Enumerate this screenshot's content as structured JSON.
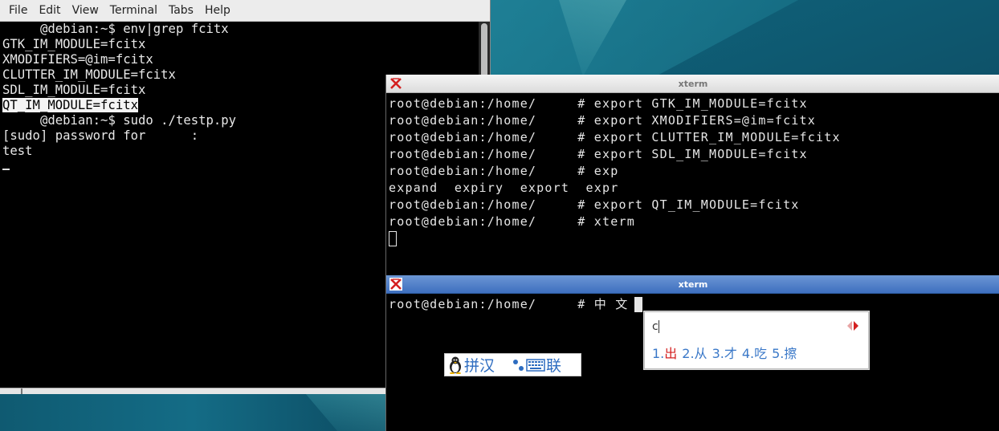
{
  "colors": {
    "terminal_bg": "#000000",
    "terminal_fg": "#e8e8e8",
    "xterm_active_title": "#3e6fbf",
    "ime_candidate": "#3a78c8",
    "ime_highlight": "#d42020"
  },
  "gnome_terminal": {
    "menu": [
      "File",
      "Edit",
      "View",
      "Terminal",
      "Tabs",
      "Help"
    ],
    "lines": [
      {
        "pre": "     ",
        "text": "@debian:~$ env|grep fcitx"
      },
      {
        "pre": "",
        "text": "GTK_IM_MODULE=fcitx"
      },
      {
        "pre": "",
        "text": "XMODIFIERS=@im=fcitx"
      },
      {
        "pre": "",
        "text": "CLUTTER_IM_MODULE=fcitx"
      },
      {
        "pre": "",
        "text": "SDL_IM_MODULE=fcitx"
      },
      {
        "pre": "",
        "text": "QT_IM_MODULE=fcitx",
        "highlight": true
      },
      {
        "pre": "     ",
        "text": "@debian:~$ sudo ./testp.py"
      },
      {
        "pre": "",
        "text": "[sudo] password for      :"
      },
      {
        "pre": "",
        "text": "test"
      }
    ]
  },
  "xterm_top": {
    "title": "xterm",
    "lines": [
      "root@debian:/home/     # export GTK_IM_MODULE=fcitx",
      "root@debian:/home/     # export XMODIFIERS=@im=fcitx",
      "root@debian:/home/     # export CLUTTER_IM_MODULE=fcitx",
      "root@debian:/home/     # export SDL_IM_MODULE=fcitx",
      "root@debian:/home/     # exp",
      "expand  expiry  export  expr",
      "root@debian:/home/     # export QT_IM_MODULE=fcitx",
      "root@debian:/home/     # xterm"
    ]
  },
  "xterm_bottom": {
    "title": "xterm",
    "line": "root@debian:/home/     # 中 文"
  },
  "ime_popup": {
    "preedit": "c",
    "candidates": [
      {
        "num": "1.",
        "word": "出"
      },
      {
        "num": "2.",
        "word": "从"
      },
      {
        "num": "3.",
        "word": "才"
      },
      {
        "num": "4.",
        "word": "吃"
      },
      {
        "num": "5.",
        "word": "擦"
      }
    ]
  },
  "ime_status": {
    "mode_text": "拼汉",
    "extra_text": "联",
    "icons": [
      "penguin-icon",
      "moon-icon",
      "punctuation-icon",
      "keyboard-icon"
    ]
  }
}
